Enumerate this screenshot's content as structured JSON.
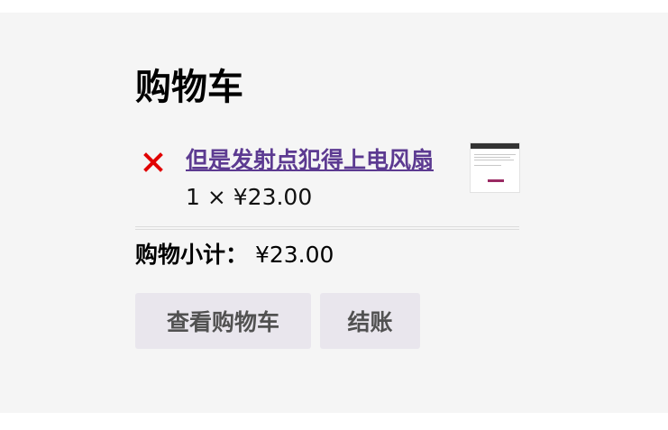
{
  "cart": {
    "title": "购物车",
    "items": [
      {
        "name": "但是发射点犯得上电风扇",
        "quantity": "1",
        "times": "×",
        "price": "¥23.00",
        "remove_icon": "close-icon",
        "remove_color": "#e10000"
      }
    ],
    "subtotal_label": "购物小计：",
    "subtotal_value": "¥23.00",
    "view_cart_label": "查看购物车",
    "checkout_label": "结账"
  }
}
